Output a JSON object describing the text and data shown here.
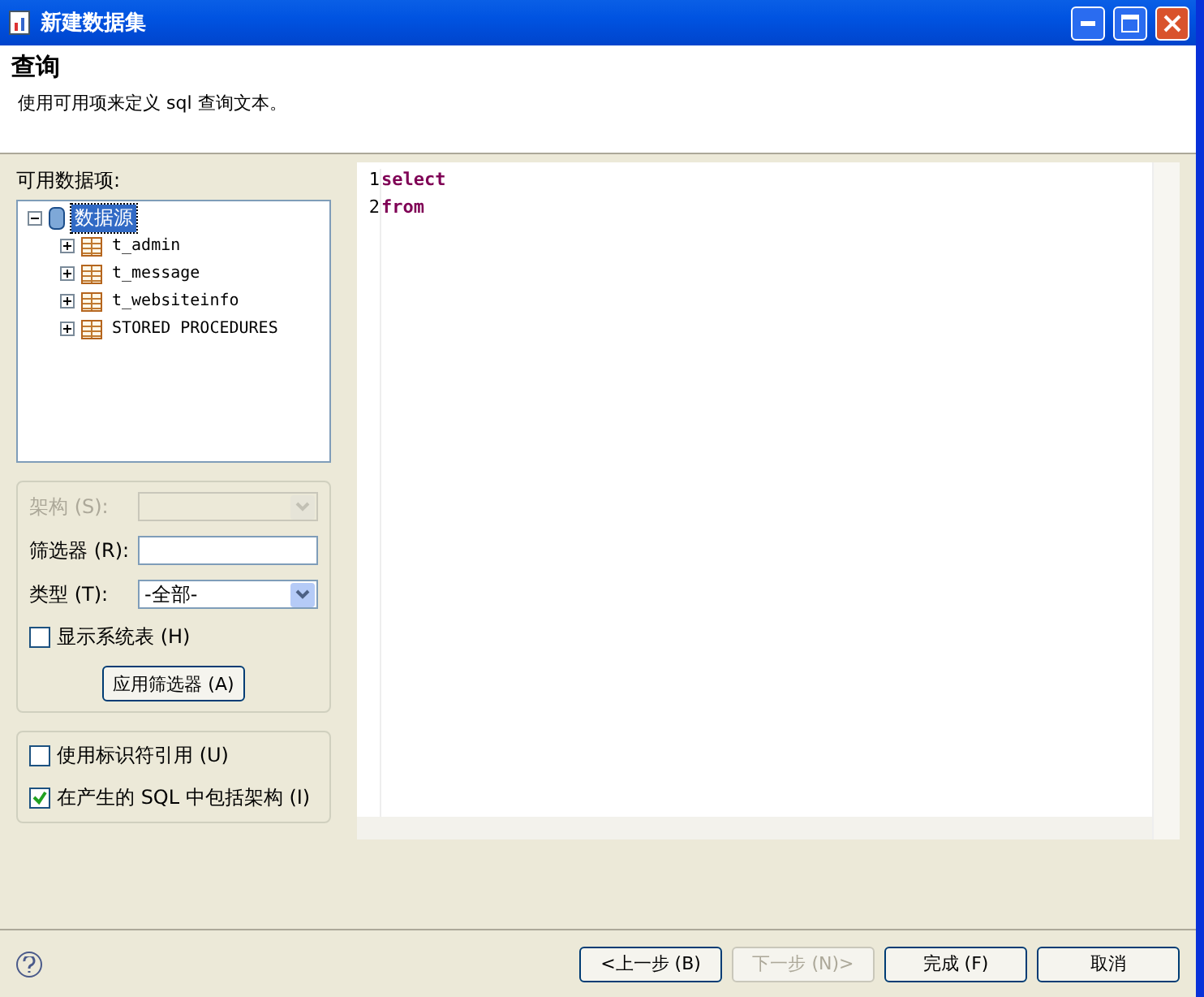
{
  "window": {
    "title": "新建数据集"
  },
  "header": {
    "title": "查询",
    "description": "使用可用项来定义 sql 查询文本。"
  },
  "available_items": {
    "label": "可用数据项:",
    "tree": [
      {
        "label": "数据源",
        "kind": "database",
        "expanded": true,
        "selected": true,
        "children": [
          {
            "label": "t_admin",
            "kind": "table",
            "expanded": false,
            "selected": false
          },
          {
            "label": "t_message",
            "kind": "table",
            "expanded": false,
            "selected": false
          },
          {
            "label": "t_websiteinfo",
            "kind": "table",
            "expanded": false,
            "selected": false
          },
          {
            "label": "STORED PROCEDURES",
            "kind": "table",
            "expanded": false,
            "selected": false
          }
        ]
      }
    ]
  },
  "filter": {
    "schema": {
      "label": "架构 (S):",
      "disabled": true
    },
    "filter_field": {
      "label": "筛选器 (R):"
    },
    "type": {
      "label": "类型 (T):",
      "value": "-全部-"
    },
    "show_system_tables": {
      "label": "显示系统表 (H)",
      "checked": false
    },
    "apply_button": "应用筛选器 (A)"
  },
  "options": [
    {
      "label": "使用标识符引用 (U)",
      "checked": false
    },
    {
      "label": "在产生的 SQL 中包括架构 (I)",
      "checked": true
    }
  ],
  "editor": {
    "lines": [
      {
        "number": "1",
        "text": "select"
      },
      {
        "number": "2",
        "text": "from"
      }
    ]
  },
  "buttons": [
    {
      "label": "<上一步 (B)",
      "disabled": false
    },
    {
      "label": "下一步 (N)>",
      "disabled": true
    },
    {
      "label": "完成 (F)",
      "disabled": false
    },
    {
      "label": "取消",
      "disabled": false
    }
  ]
}
